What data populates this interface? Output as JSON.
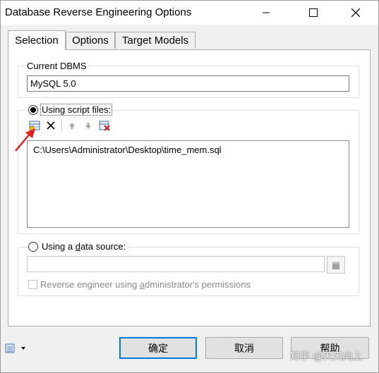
{
  "window": {
    "title": "Database Reverse Engineering Options"
  },
  "tabs": [
    {
      "label": "Selection",
      "active": true
    },
    {
      "label": "Options",
      "active": false
    },
    {
      "label": "Target Models",
      "active": false
    }
  ],
  "current_dbms": {
    "label": "Current DBMS",
    "value": "MySQL 5.0"
  },
  "script_files": {
    "radio_label": "Using script files:",
    "selected": true,
    "toolbar": [
      "add-script-icon",
      "delete-icon",
      "move-up-icon",
      "move-down-icon",
      "clear-list-icon"
    ],
    "files": [
      "C:\\Users\\Administrator\\Desktop\\time_mem.sql"
    ]
  },
  "data_source": {
    "radio_pre": "Using a ",
    "radio_u": "d",
    "radio_post": "ata source:",
    "selected": false,
    "value": "",
    "checkbox_pre": "Reverse engineer using ",
    "checkbox_u": "a",
    "checkbox_post": "dministrator's permissions",
    "checkbox_checked": false
  },
  "buttons": {
    "ok": "确定",
    "cancel": "取消",
    "help": "帮助"
  },
  "watermark": "知乎 @天天向上",
  "colors": {
    "accent": "#0078d7",
    "arrow": "#e02020"
  }
}
